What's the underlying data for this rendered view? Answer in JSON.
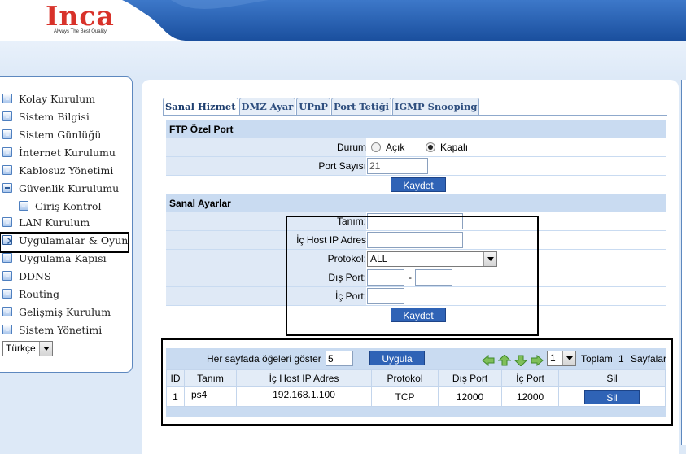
{
  "brand": {
    "name": "Inca",
    "tagline": "Always The Best Quality"
  },
  "sidebar": {
    "items": [
      {
        "label": "Kolay Kurulum",
        "icon": "square-bullet-icon"
      },
      {
        "label": "Sistem Bilgisi",
        "icon": "square-bullet-icon"
      },
      {
        "label": "Sistem Günlüğü",
        "icon": "square-bullet-icon"
      },
      {
        "label": "İnternet Kurulumu",
        "icon": "square-bullet-icon"
      },
      {
        "label": "Kablosuz Yönetimi",
        "icon": "square-bullet-icon"
      },
      {
        "label": "Güvenlik Kurulumu",
        "icon": "collapse-icon"
      },
      {
        "label": "Giriş Kontrol",
        "icon": "square-bullet-icon"
      },
      {
        "label": "LAN Kurulum",
        "icon": "square-bullet-icon"
      },
      {
        "label": "Uygulamalar & Oyun",
        "icon": "arrow-right-icon"
      },
      {
        "label": "Uygulama Kapısı",
        "icon": "square-bullet-icon"
      },
      {
        "label": "DDNS",
        "icon": "square-bullet-icon"
      },
      {
        "label": "Routing",
        "icon": "square-bullet-icon"
      },
      {
        "label": "Gelişmiş Kurulum",
        "icon": "square-bullet-icon"
      },
      {
        "label": "Sistem Yönetimi",
        "icon": "square-bullet-icon"
      }
    ],
    "language": "Türkçe"
  },
  "tabs": [
    "Sanal Hizmet",
    "DMZ Ayar",
    "UPnP",
    "Port Tetiği",
    "IGMP Snooping"
  ],
  "ftp": {
    "title": "FTP Özel Port",
    "status_label": "Durum",
    "open_label": "Açık",
    "closed_label": "Kapalı",
    "port_label": "Port Sayısı",
    "port_value": "21",
    "save": "Kaydet"
  },
  "virtual": {
    "title": "Sanal Ayarlar",
    "name_label": "Tanım:",
    "host_label": "İç Host IP Adres",
    "protocol_label": "Protokol:",
    "protocol_value": "ALL",
    "ext_port_label": "Dış Port:",
    "port_sep": "-",
    "int_port_label": "İç Port:",
    "save": "Kaydet"
  },
  "list": {
    "per_page_label": "Her sayfada öğeleri göster",
    "per_page_value": "5",
    "apply": "Uygula",
    "page_value": "1",
    "total_label": "Toplam",
    "total_value": "1",
    "pages_label": "Sayfalar",
    "columns": [
      "ID",
      "Tanım",
      "İç Host IP Adres",
      "Protokol",
      "Dış Port",
      "İç Port",
      "Sil"
    ],
    "rows": [
      {
        "id": "1",
        "name": "ps4",
        "ip": "192.168.1.100",
        "protocol": "TCP",
        "ext_port": "12000",
        "int_port": "12000",
        "delete": "Sil"
      }
    ]
  }
}
